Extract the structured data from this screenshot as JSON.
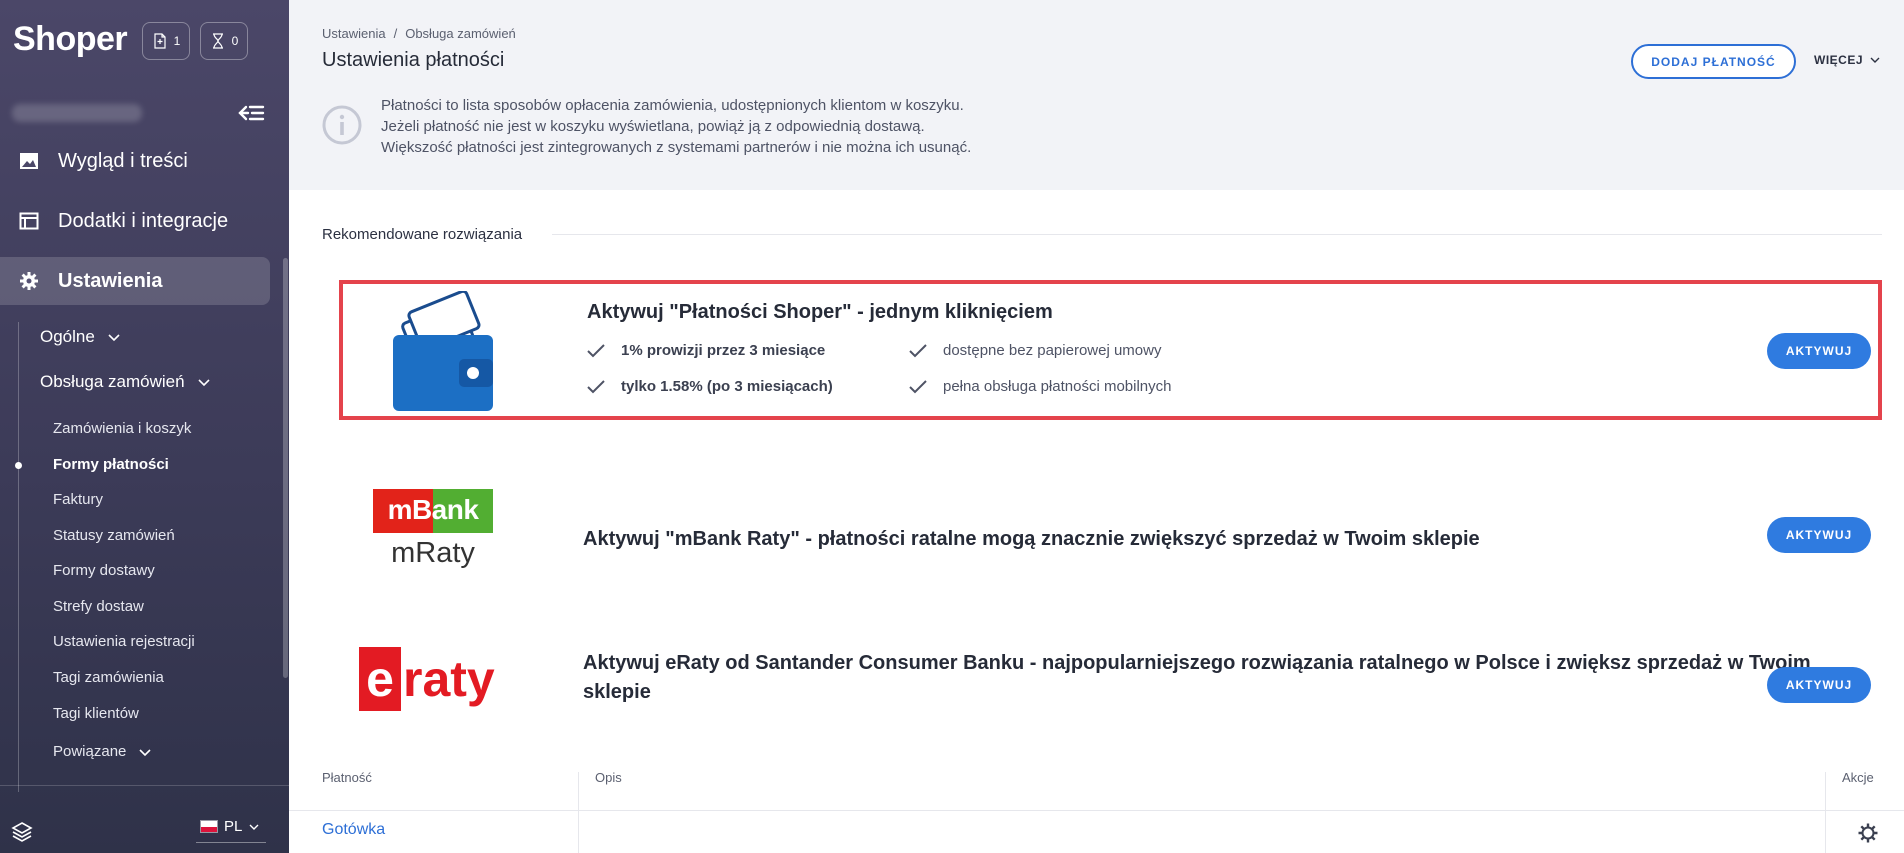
{
  "app": {
    "logo": "Shoper"
  },
  "topbar": {
    "badge_tasks": "1",
    "badge_timer": "0"
  },
  "sidebar": {
    "main_items": [
      {
        "label": "Wygląd i treści",
        "icon": "image-icon"
      },
      {
        "label": "Dodatki i integracje",
        "icon": "window-icon"
      },
      {
        "label": "Ustawienia",
        "icon": "gear-icon"
      }
    ],
    "sub_items": [
      {
        "label": "Ogólne"
      },
      {
        "label": "Obsługa zamówień"
      }
    ],
    "leaf_items": [
      {
        "label": "Zamówienia i koszyk"
      },
      {
        "label": "Formy płatności"
      },
      {
        "label": "Faktury"
      },
      {
        "label": "Statusy zamówień"
      },
      {
        "label": "Formy dostawy"
      },
      {
        "label": "Strefy dostaw"
      },
      {
        "label": "Ustawienia rejestracji"
      },
      {
        "label": "Tagi zamówienia"
      },
      {
        "label": "Tagi klientów"
      },
      {
        "label": "Powiązane"
      }
    ],
    "language": "PL"
  },
  "header": {
    "breadcrumb": [
      "Ustawienia",
      "/",
      "Obsługa zamówień"
    ],
    "title": "Ustawienia płatności",
    "add_button": "DODAJ PŁATNOŚĆ",
    "more_button": "WIĘCEJ",
    "info_lines": [
      "Płatności to lista sposobów opłacenia zamówienia, udostępnionych klientom w koszyku.",
      "Jeżeli płatność nie jest w koszyku wyświetlana, powiąż ją z odpowiednią dostawą.",
      "Większość płatności jest zintegrowanych z systemami partnerów i nie można ich usunąć."
    ]
  },
  "recommended": {
    "title": "Rekomendowane rozwiązania",
    "items": [
      {
        "title": "Aktywuj \"Płatności Shoper\" - jednym kliknięciem",
        "features": [
          "1% prowizji przez 3 miesiące",
          "dostępne bez papierowej umowy",
          "tylko 1.58% (po 3 miesiącach)",
          "pełna obsługa płatności mobilnych"
        ],
        "button": "AKTYWUJ"
      },
      {
        "title": "Aktywuj \"mBank Raty\" - płatności ratalne mogą znacznie zwiększyć sprzedaż w Twoim sklepie",
        "logo_top": "mBank",
        "logo_bottom": "mRaty",
        "button": "AKTYWUJ"
      },
      {
        "title_line1": "Aktywuj eRaty od Santander Consumer Banku - najpopularniejszego rozwiązania ratalnego w Polsce i zwiększ sprzedaż w Twoim",
        "title_line2": "sklepie",
        "logo_e": "e",
        "logo_rest": "raty",
        "button": "AKTYWUJ"
      }
    ]
  },
  "table": {
    "headers": [
      "Płatność",
      "Opis",
      "Akcje"
    ],
    "rows": [
      {
        "name": "Gotówka",
        "description": ""
      }
    ]
  },
  "colors": {
    "accent": "#2f7be0",
    "highlight": "#e4434c",
    "sidebar": "#3c3b58",
    "mbank_red": "#e2231a",
    "mbank_green": "#52ae32"
  }
}
